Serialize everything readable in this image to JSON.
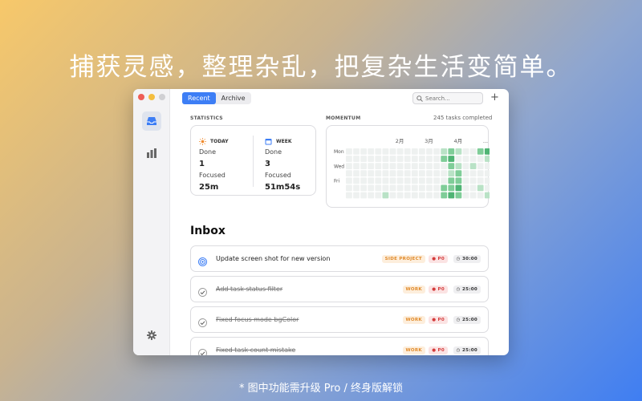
{
  "headline": "捕获灵感，整理杂乱，把复杂生活变简单。",
  "footnote": "* 图中功能需升级 Pro / 终身版解锁",
  "tabs": [
    {
      "label": "Recent",
      "active": true
    },
    {
      "label": "Archive",
      "active": false
    }
  ],
  "search": {
    "placeholder": "Search..."
  },
  "statistics": {
    "title": "STATISTICS",
    "today": {
      "label": "TODAY",
      "done_label": "Done",
      "done_value": "1",
      "focused_label": "Focused",
      "focused_value": "25m"
    },
    "week": {
      "label": "WEEK",
      "done_label": "Done",
      "done_value": "3",
      "focused_label": "Focused",
      "focused_value": "51m54s"
    }
  },
  "momentum": {
    "title": "MOMENTUM",
    "completed": "245 tasks completed",
    "months": [
      "2月",
      "3月",
      "4月",
      "..."
    ],
    "days": [
      "Mon",
      "Wed",
      "Fri"
    ],
    "levels": [
      [
        0,
        0,
        0,
        0,
        0,
        0,
        0,
        0,
        0,
        0,
        0,
        0,
        0,
        1,
        2,
        1,
        0,
        0,
        2,
        3,
        1
      ],
      [
        0,
        0,
        0,
        0,
        0,
        0,
        0,
        0,
        0,
        0,
        0,
        0,
        0,
        2,
        3,
        0,
        0,
        0,
        0,
        1,
        0
      ],
      [
        0,
        0,
        0,
        0,
        0,
        0,
        0,
        0,
        0,
        0,
        0,
        0,
        0,
        0,
        2,
        1,
        0,
        1,
        0,
        0,
        0
      ],
      [
        0,
        0,
        0,
        0,
        0,
        0,
        0,
        0,
        0,
        0,
        0,
        0,
        0,
        0,
        1,
        2,
        0,
        0,
        0,
        0,
        0
      ],
      [
        0,
        0,
        0,
        0,
        0,
        0,
        0,
        0,
        0,
        0,
        0,
        0,
        0,
        0,
        2,
        2,
        0,
        0,
        0,
        0,
        0
      ],
      [
        0,
        0,
        0,
        0,
        0,
        0,
        0,
        0,
        0,
        0,
        0,
        0,
        0,
        2,
        2,
        3,
        0,
        0,
        1,
        0,
        0
      ],
      [
        0,
        0,
        0,
        0,
        0,
        1,
        0,
        0,
        0,
        0,
        0,
        0,
        0,
        2,
        3,
        2,
        0,
        0,
        0,
        1,
        0
      ]
    ]
  },
  "inbox": {
    "title": "Inbox",
    "tasks": [
      {
        "name": "Update screen shot for new version",
        "done": false,
        "tag": "SIDE PROJECT",
        "priority": "P0",
        "time": "30:00"
      },
      {
        "name": "Add task status filter",
        "done": true,
        "tag": "WORK",
        "priority": "P0",
        "time": "25:00"
      },
      {
        "name": "Fixed focus mode bgColor",
        "done": true,
        "tag": "WORK",
        "priority": "P0",
        "time": "25:00"
      },
      {
        "name": "Fixed task count mistake",
        "done": true,
        "tag": "WORK",
        "priority": "P0",
        "time": "25:00"
      }
    ]
  },
  "colors": {
    "accent": "#3d7ef5",
    "heat_levels": [
      "#eef1f0",
      "#b9e2c6",
      "#7fcd98",
      "#4fb474"
    ]
  },
  "icons": {
    "inbox": "inbox-icon",
    "stats": "bar-chart-icon",
    "settings": "gear-icon",
    "search": "search-icon",
    "add": "plus-icon",
    "today": "sun-icon",
    "week": "calendar-icon"
  }
}
